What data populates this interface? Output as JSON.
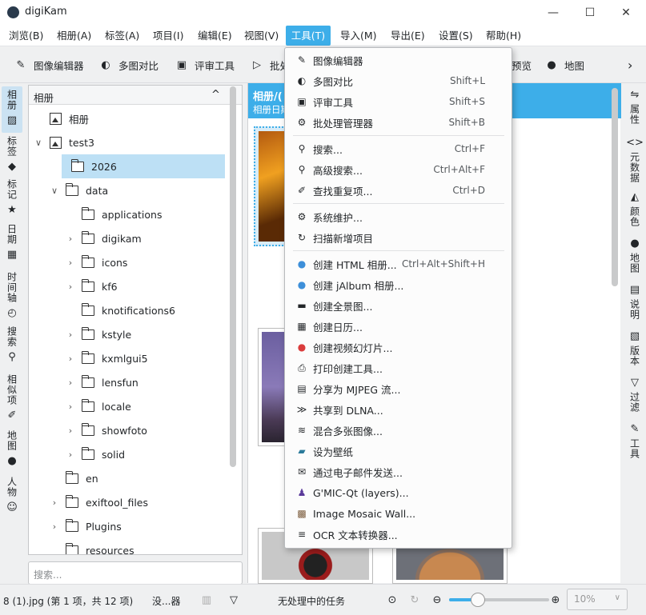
{
  "window": {
    "title": "digiKam",
    "minimize": "—",
    "maximize": "☐",
    "close": "✕"
  },
  "menubar": [
    "浏览(B)",
    "相册(A)",
    "标签(A)",
    "项目(I)",
    "编辑(E)",
    "视图(V)",
    "工具(T)",
    "导入(M)",
    "导出(E)",
    "设置(S)",
    "帮助(H)"
  ],
  "toolbar": {
    "image_editor": "图像编辑器",
    "light_table": "多图对比",
    "review": "评审工具",
    "batch": "批处",
    "preview": "预览",
    "map": "地图",
    "more": "›"
  },
  "left_tabs": [
    "相册",
    "标签",
    "标记",
    "日期",
    "时间轴",
    "搜索",
    "相似项",
    "地图",
    "人物"
  ],
  "album_panel": {
    "header": "相册",
    "collapse": "^",
    "tree": [
      {
        "label": "相册",
        "level": 0,
        "type": "root"
      },
      {
        "label": "test3",
        "level": 0,
        "type": "album",
        "caret": "v"
      },
      {
        "label": "2026",
        "level": 1,
        "type": "folder",
        "selected": true
      },
      {
        "label": "data",
        "level": 1,
        "type": "folder",
        "caret": "v"
      },
      {
        "label": "applications",
        "level": 2,
        "type": "folder"
      },
      {
        "label": "digikam",
        "level": 2,
        "type": "folder",
        "caret": ">"
      },
      {
        "label": "icons",
        "level": 2,
        "type": "folder",
        "caret": ">"
      },
      {
        "label": "kf6",
        "level": 2,
        "type": "folder",
        "caret": ">"
      },
      {
        "label": "knotifications6",
        "level": 2,
        "type": "folder"
      },
      {
        "label": "kstyle",
        "level": 2,
        "type": "folder",
        "caret": ">"
      },
      {
        "label": "kxmlgui5",
        "level": 2,
        "type": "folder",
        "caret": ">"
      },
      {
        "label": "lensfun",
        "level": 2,
        "type": "folder",
        "caret": ">"
      },
      {
        "label": "locale",
        "level": 2,
        "type": "folder",
        "caret": ">"
      },
      {
        "label": "showfoto",
        "level": 2,
        "type": "folder",
        "caret": ">"
      },
      {
        "label": "solid",
        "level": 2,
        "type": "folder",
        "caret": ">"
      },
      {
        "label": "en",
        "level": 1,
        "type": "folder"
      },
      {
        "label": "exiftool_files",
        "level": 1,
        "type": "folder",
        "caret": ">"
      },
      {
        "label": "Plugins",
        "level": 1,
        "type": "folder",
        "caret": ">"
      },
      {
        "label": "resources",
        "level": 1,
        "type": "folder"
      }
    ],
    "search_placeholder": "搜索..."
  },
  "main": {
    "header_title": "相册/(",
    "header_sub": "相册日期"
  },
  "right_tabs": [
    "属性",
    "元数据",
    "颜色",
    "地图",
    "说明",
    "版本",
    "过滤",
    "工具"
  ],
  "tools_menu": [
    {
      "icon": "pencil-icon",
      "glyph": "✎",
      "label": "图像编辑器",
      "shortcut": ""
    },
    {
      "icon": "contrast-icon",
      "glyph": "◐",
      "label": "多图对比",
      "shortcut": "Shift+L"
    },
    {
      "icon": "review-icon",
      "glyph": "▣",
      "label": "评审工具",
      "shortcut": "Shift+S"
    },
    {
      "icon": "batch-gear-icon",
      "glyph": "⚙",
      "label": "批处理管理器",
      "shortcut": "Shift+B"
    },
    {
      "sep": true
    },
    {
      "icon": "search-icon",
      "glyph": "⚲",
      "label": "搜索...",
      "shortcut": "Ctrl+F"
    },
    {
      "icon": "advanced-search-icon",
      "glyph": "⚲",
      "label": "高级搜索...",
      "shortcut": "Ctrl+Alt+F"
    },
    {
      "icon": "brush-icon",
      "glyph": "✐",
      "label": "查找重复项...",
      "shortcut": "Ctrl+D"
    },
    {
      "sep": true
    },
    {
      "icon": "maintenance-icon",
      "glyph": "⚙",
      "label": "系统维护...",
      "shortcut": ""
    },
    {
      "icon": "rescan-icon",
      "glyph": "↻",
      "label": "扫描新增项目",
      "shortcut": ""
    },
    {
      "sep": true
    },
    {
      "icon": "html-globe-icon",
      "glyph": "●",
      "label": "创建 HTML 相册...",
      "shortcut": "Ctrl+Alt+Shift+H"
    },
    {
      "icon": "jalbum-globe-icon",
      "glyph": "●",
      "label": "创建 jAlbum 相册...",
      "shortcut": ""
    },
    {
      "icon": "panorama-icon",
      "glyph": "▬",
      "label": "创建全景图...",
      "shortcut": ""
    },
    {
      "icon": "calendar-icon",
      "glyph": "▦",
      "label": "创建日历...",
      "shortcut": ""
    },
    {
      "icon": "video-slideshow-icon",
      "glyph": "●",
      "label": "创建视频幻灯片...",
      "shortcut": ""
    },
    {
      "icon": "print-icon",
      "glyph": "⎙",
      "label": "打印创建工具...",
      "shortcut": ""
    },
    {
      "icon": "film-icon",
      "glyph": "▤",
      "label": "分享为 MJPEG 流...",
      "shortcut": ""
    },
    {
      "icon": "dlna-icon",
      "glyph": "≫",
      "label": "共享到 DLNA...",
      "shortcut": ""
    },
    {
      "icon": "blend-icon",
      "glyph": "≋",
      "label": "混合多张图像...",
      "shortcut": ""
    },
    {
      "icon": "wallpaper-icon",
      "glyph": "▰",
      "label": "设为壁纸",
      "shortcut": ""
    },
    {
      "icon": "email-icon",
      "glyph": "✉",
      "label": "通过电子邮件发送...",
      "shortcut": ""
    },
    {
      "icon": "gmic-wizard-icon",
      "glyph": "♟",
      "label": "G'MIC-Qt (layers)...",
      "shortcut": ""
    },
    {
      "icon": "mosaic-icon",
      "glyph": "▩",
      "label": "Image Mosaic Wall...",
      "shortcut": ""
    },
    {
      "icon": "ocr-icon",
      "glyph": "≡",
      "label": "OCR 文本转换器...",
      "shortcut": ""
    }
  ],
  "status": {
    "selection": "8 (1).jpg (第 1 项，共 12 项)",
    "device": "没...器",
    "queue": "无处理中的任务",
    "zoom_level": 0.29,
    "zoom_value": "10%"
  },
  "colors": {
    "accent": "#3daee9",
    "selection": "#bde0f5"
  }
}
